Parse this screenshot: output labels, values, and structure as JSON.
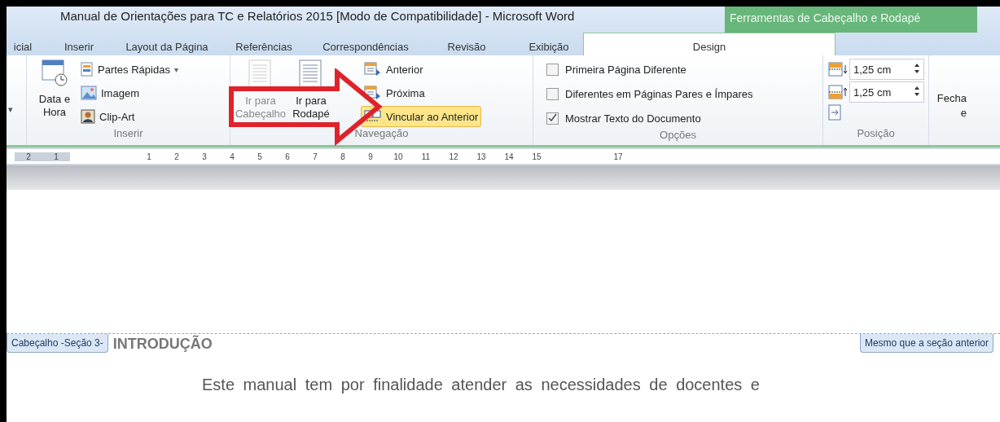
{
  "window": {
    "title": "Manual de Orientações para TC e Relatórios 2015 [Modo de Compatibilidade]  -  Microsoft Word",
    "context_tab": "Ferramentas de Cabeçalho e Rodapé"
  },
  "tabs": [
    {
      "label": "icial",
      "selected": false
    },
    {
      "label": "Inserir",
      "selected": false
    },
    {
      "label": "Layout da Página",
      "selected": false
    },
    {
      "label": "Referências",
      "selected": false
    },
    {
      "label": "Correspondências",
      "selected": false
    },
    {
      "label": "Revisão",
      "selected": false
    },
    {
      "label": "Exibição",
      "selected": false
    },
    {
      "label": "Design",
      "selected": true
    }
  ],
  "ribbon": {
    "left_caret": "▾",
    "inserir": {
      "label": "Inserir",
      "date_button": "Data e Hora",
      "items": [
        {
          "label": "Partes Rápidas",
          "caret": "▾"
        },
        {
          "label": "Imagem"
        },
        {
          "label": "Clip-Art"
        }
      ]
    },
    "navegacao": {
      "label": "Navegação",
      "big_buttons": [
        {
          "label": "Ir para Cabeçalho",
          "disabled": true
        },
        {
          "label": "Ir para Rodapé",
          "disabled": false
        }
      ],
      "items": [
        {
          "label": "Anterior",
          "selected": false
        },
        {
          "label": "Próxima",
          "selected": false
        },
        {
          "label": "Vincular ao Anterior",
          "selected": true
        }
      ]
    },
    "opcoes": {
      "label": "Opções",
      "checkboxes": [
        {
          "label": "Primeira Página Diferente",
          "checked": false
        },
        {
          "label": "Diferentes em Páginas Pares e Ímpares",
          "checked": false
        },
        {
          "label": "Mostrar Texto do Documento",
          "checked": true
        }
      ]
    },
    "posicao": {
      "label": "Posição",
      "spinners": [
        {
          "value": "1,25 cm"
        },
        {
          "value": "1,25 cm"
        }
      ]
    },
    "fechar": {
      "label": "Fecha e"
    }
  },
  "ruler": {
    "labels": [
      "2",
      "1",
      "1",
      "2",
      "3",
      "4",
      "5",
      "6",
      "7",
      "8",
      "9",
      "10",
      "11",
      "12",
      "13",
      "14",
      "15",
      "17"
    ]
  },
  "document": {
    "header_tag": "Cabeçalho -Seção 3-",
    "heading": "INTRODUÇÃO",
    "link_tag": "Mesmo que a seção anterior",
    "paragraph": "Este manual tem por finalidade atender as necessidades de docentes e"
  }
}
